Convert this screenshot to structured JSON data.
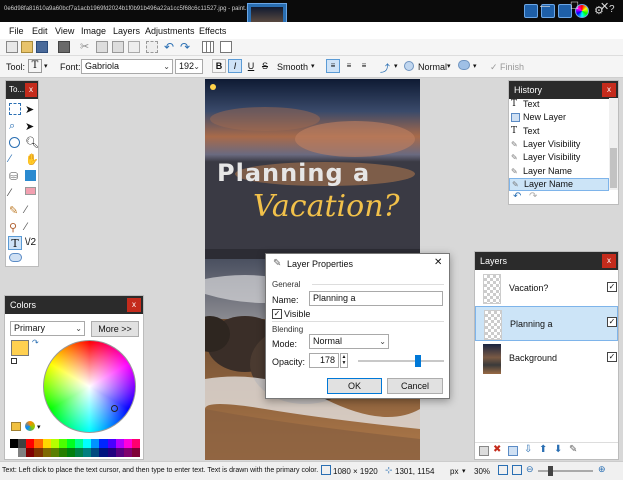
{
  "titlebar": {
    "title": "0e6d98fa81610a9a60bcf7a1acb1969fd2024b1f0b91b496a22a1cc5f68c6c11527.jpg - paint.net 4.0.13",
    "buttons": [
      "minimize-icon",
      "maximize-icon",
      "close-icon"
    ]
  },
  "menu": {
    "items": [
      "File",
      "Edit",
      "View",
      "Image",
      "Layers",
      "Adjustments",
      "Effects"
    ]
  },
  "toolbar2": {
    "tool_label": "Tool:",
    "tool_value": "T",
    "font_label": "Font:",
    "font_value": "Gabriola",
    "size_value": "192",
    "bold": "B",
    "italic": "I",
    "underline": "U",
    "strike": "S",
    "antialias": "Smooth",
    "blend_mode": "Normal",
    "finish": "Finish"
  },
  "tools_panel": {
    "title": "To...",
    "close": "x"
  },
  "colors_panel": {
    "title": "Colors",
    "close": "x",
    "mode": "Primary",
    "more_button": "More >>",
    "palette": [
      "#000000",
      "#404040",
      "#ff0000",
      "#ff6a00",
      "#ffd800",
      "#b6ff00",
      "#4cff00",
      "#00ff21",
      "#00ff90",
      "#00ffff",
      "#0094ff",
      "#0026ff",
      "#4800ff",
      "#b200ff",
      "#ff00dc",
      "#ff006e",
      "#ffffff",
      "#808080",
      "#7f0000",
      "#7f3300",
      "#7f6a00",
      "#5b7f00",
      "#267f00",
      "#007f0e",
      "#007f46",
      "#007f7f",
      "#004a7f",
      "#00137f",
      "#21007f",
      "#57007f",
      "#7f006e",
      "#7f0037"
    ],
    "primary_color": "#ffd050",
    "secondary_color": "#ffffff"
  },
  "history_panel": {
    "title": "History",
    "close": "x",
    "items": [
      {
        "label": "Text",
        "icon": "text-icon"
      },
      {
        "label": "New Layer",
        "icon": "new-layer-icon"
      },
      {
        "label": "Text",
        "icon": "text-icon"
      },
      {
        "label": "Layer Visibility",
        "icon": "layer-properties-icon"
      },
      {
        "label": "Layer Visibility",
        "icon": "layer-properties-icon"
      },
      {
        "label": "Layer Name",
        "icon": "layer-properties-icon"
      },
      {
        "label": "Layer Name",
        "icon": "layer-properties-icon"
      }
    ],
    "selected_index": 6
  },
  "layers_panel": {
    "title": "Layers",
    "close": "x",
    "layers": [
      {
        "name": "Vacation?",
        "visible": true,
        "selected": false
      },
      {
        "name": "Planning a",
        "visible": true,
        "selected": true
      },
      {
        "name": "Background",
        "visible": true,
        "selected": false
      }
    ]
  },
  "canvas_text": {
    "line1": "Planning a",
    "line2": "Vacation?"
  },
  "dialog": {
    "title": "Layer Properties",
    "close": "✕",
    "general_label": "General",
    "name_label": "Name:",
    "name_value": "Planning a",
    "visible_label": "Visible",
    "visible_checked": true,
    "blending_label": "Blending",
    "mode_label": "Mode:",
    "mode_value": "Normal",
    "opacity_label": "Opacity:",
    "opacity_value": "178",
    "opacity_fraction": 0.698,
    "ok_label": "OK",
    "cancel_label": "Cancel"
  },
  "statusbar": {
    "hint": "Text: Left click to place the text cursor, and then type to enter text. Text is drawn with the primary color.",
    "image_size": "1080 × 1920",
    "cursor_pos": "1301, 1154",
    "units": "px",
    "zoom": "30%"
  }
}
